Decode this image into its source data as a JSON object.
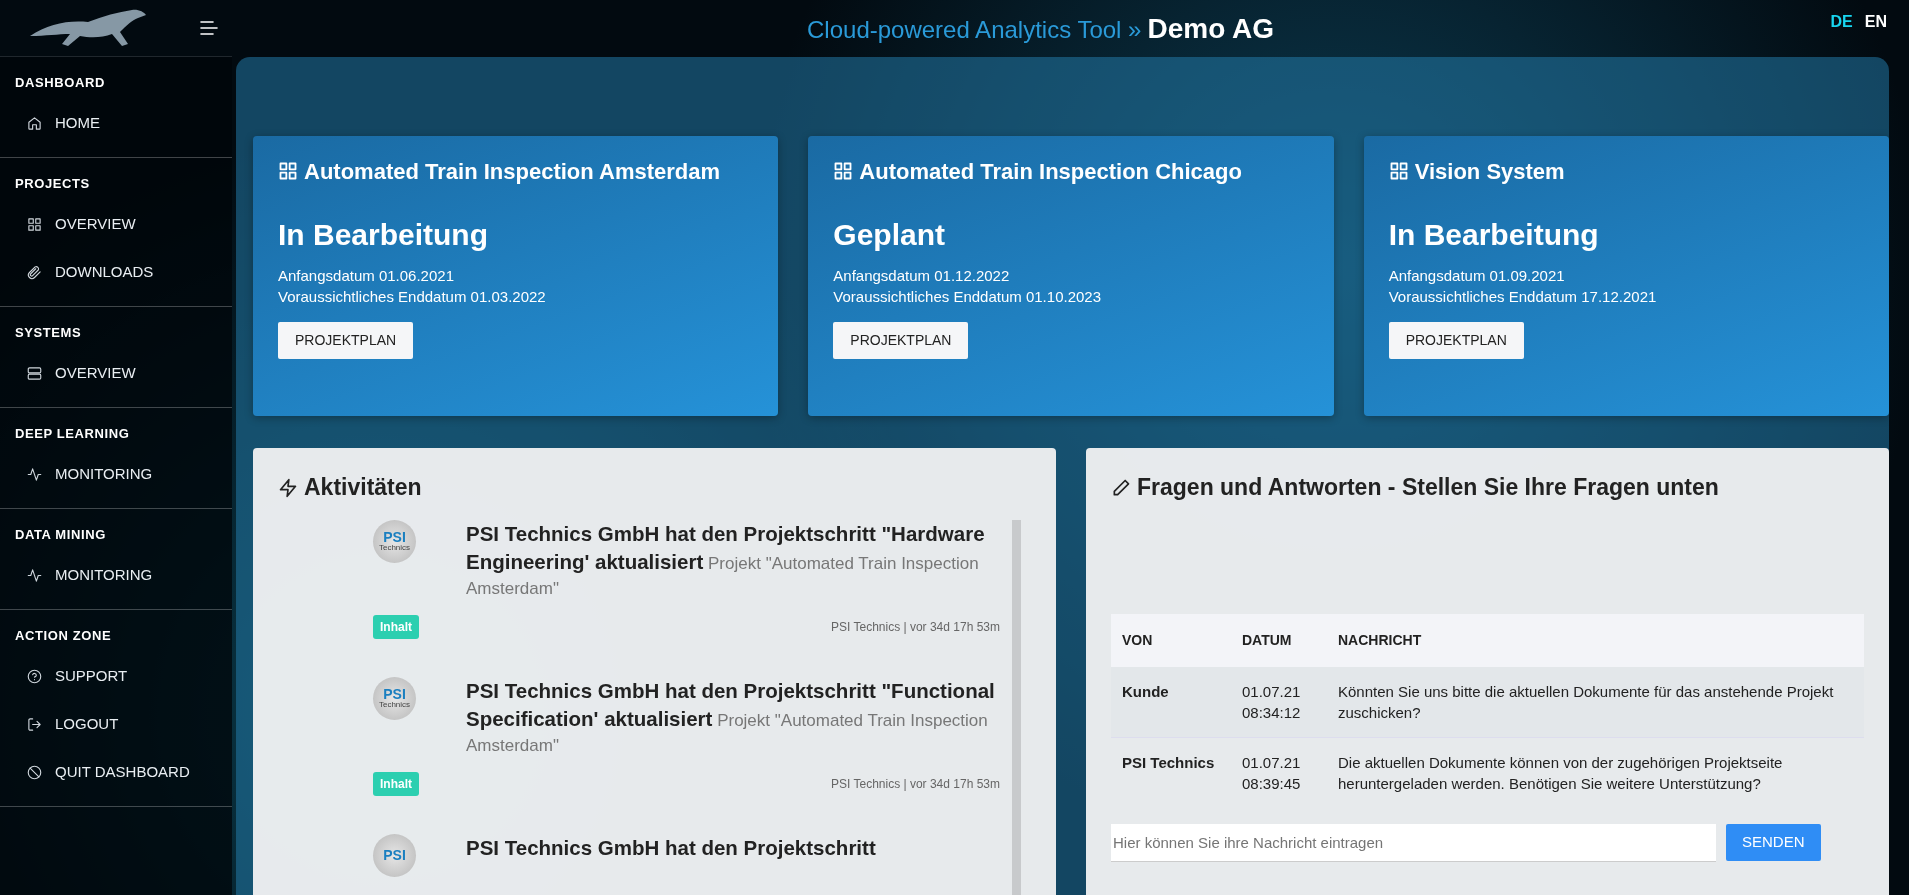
{
  "topbar": {
    "app_title": "Cloud-powered Analytics Tool »",
    "company": "Demo AG"
  },
  "languages": [
    {
      "label": "DE",
      "selected": true
    },
    {
      "label": "EN",
      "selected": false
    }
  ],
  "sidebar": {
    "sections": [
      {
        "heading": "DASHBOARD",
        "items": [
          {
            "label": "HOME",
            "kind": "home"
          }
        ]
      },
      {
        "heading": "PROJECTS",
        "items": [
          {
            "label": "OVERVIEW",
            "kind": "grid"
          },
          {
            "label": "DOWNLOADS",
            "kind": "paperclip"
          }
        ]
      },
      {
        "heading": "SYSTEMS",
        "items": [
          {
            "label": "OVERVIEW",
            "kind": "server"
          }
        ]
      },
      {
        "heading": "DEEP LEARNING",
        "items": [
          {
            "label": "MONITORING",
            "kind": "activity"
          }
        ]
      },
      {
        "heading": "DATA MINING",
        "items": [
          {
            "label": "MONITORING",
            "kind": "activity"
          }
        ]
      },
      {
        "heading": "ACTION ZONE",
        "items": [
          {
            "label": "SUPPORT",
            "kind": "help"
          },
          {
            "label": "LOGOUT",
            "kind": "logout"
          },
          {
            "label": "QUIT DASHBOARD",
            "kind": "ban"
          }
        ]
      }
    ]
  },
  "projects": [
    {
      "title": "Automated Train Inspection Amsterdam",
      "status": "In Bearbeitung",
      "start": "Anfangsdatum 01.06.2021",
      "end": "Voraussichtliches Enddatum 01.03.2022",
      "button": "PROJEKTPLAN"
    },
    {
      "title": "Automated Train Inspection Chicago",
      "status": "Geplant",
      "start": "Anfangsdatum 01.12.2022",
      "end": "Voraussichtliches Enddatum 01.10.2023",
      "button": "PROJEKTPLAN"
    },
    {
      "title": "Vision System",
      "status": "In Bearbeitung",
      "start": "Anfangsdatum 01.09.2021",
      "end": "Voraussichtliches Enddatum 17.12.2021",
      "button": "PROJEKTPLAN"
    }
  ],
  "activities": {
    "title": "Aktivitäten",
    "items": [
      {
        "logo_text": "PSI",
        "logo_caption": "Technics",
        "headline": "PSI Technics GmbH hat den Projektschritt \"Hardware Engineering' aktualisiert",
        "project": "Projekt \"Automated Train Inspection Amsterdam\"",
        "tag": "Inhalt",
        "meta": "PSI Technics | vor 34d 17h 53m"
      },
      {
        "logo_text": "PSI",
        "logo_caption": "Technics",
        "headline": "PSI Technics GmbH hat den Projektschritt \"Functional Specification' aktualisiert",
        "project": "Projekt \"Automated Train Inspection Amsterdam\"",
        "tag": "Inhalt",
        "meta": "PSI Technics | vor 34d 17h 53m"
      },
      {
        "logo_text": "PSI",
        "headline": "PSI Technics GmbH hat den Projektschritt"
      }
    ]
  },
  "questions": {
    "title": "Fragen und Antworten - Stellen Sie Ihre Fragen unten",
    "table": {
      "columns": [
        "VON",
        "DATUM",
        "NACHRICHT"
      ],
      "rows": [
        [
          "Kunde",
          "01.07.21 08:34:12",
          "Könnten Sie uns bitte die aktuellen Dokumente für das anstehende Projekt zuschicken?"
        ],
        [
          "PSI Technics",
          "01.07.21 08:39:45",
          "Die aktuellen Dokumente können von der zugehörigen Projektseite heruntergeladen werden. Benötigen Sie weitere Unterstützung?"
        ]
      ]
    },
    "input": {
      "placeholder": "Hier können Sie ihre Nachricht eintragen"
    },
    "send_button": "SENDEN"
  }
}
